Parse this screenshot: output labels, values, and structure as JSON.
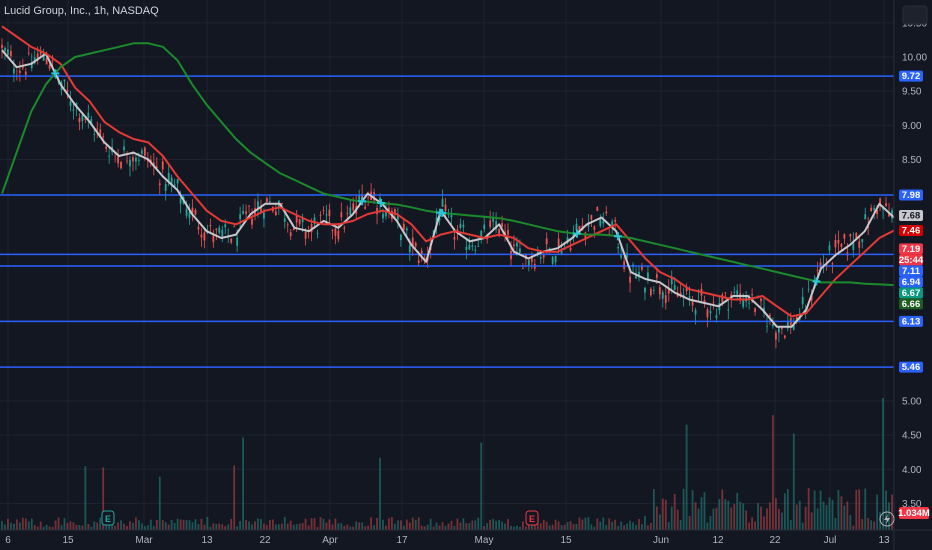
{
  "header": {
    "title": "Lucid Group, Inc., 1h, NASDAQ"
  },
  "chart_data": {
    "type": "candlestick",
    "symbol": "Lucid Group, Inc.",
    "interval": "1h",
    "exchange": "NASDAQ",
    "y_axis": {
      "ticks": [
        "10.50",
        "10.00",
        "9.50",
        "9.00",
        "8.50",
        "5.00",
        "4.50",
        "4.00",
        "3.50"
      ],
      "tick_values": [
        10.5,
        10.0,
        9.5,
        9.0,
        8.5,
        5.0,
        4.5,
        4.0,
        3.5
      ],
      "ylim": [
        5.2,
        10.7
      ]
    },
    "x_axis": {
      "ticks": [
        "6",
        "15",
        "Mar",
        "13",
        "22",
        "Apr",
        "17",
        "May",
        "15",
        "Jun",
        "12",
        "22",
        "Jul",
        "13"
      ]
    },
    "horizontal_lines": [
      9.72,
      7.98,
      7.11,
      6.94,
      6.13,
      5.46
    ],
    "price_tags": [
      {
        "label": "9.72",
        "value": 9.72,
        "bg": "#2962ff",
        "fg": "#ffffff"
      },
      {
        "label": "7.98",
        "value": 7.98,
        "bg": "#2962ff",
        "fg": "#ffffff"
      },
      {
        "label": "7.68",
        "value": 7.68,
        "bg": "#c8c8cc",
        "fg": "#131722"
      },
      {
        "label": "7.46",
        "value": 7.46,
        "bg": "#d50000",
        "fg": "#ffffff"
      },
      {
        "label": "7.19",
        "value": 7.19,
        "bg": "#f23645",
        "fg": "#ffffff"
      },
      {
        "label": "25:44",
        "value": 7.09,
        "bg": "#f23645",
        "fg": "#ffffff"
      },
      {
        "label": "7.11",
        "value": 7.11,
        "bg": "#2962ff",
        "fg": "#ffffff"
      },
      {
        "label": "6.94",
        "value": 6.94,
        "bg": "#2962ff",
        "fg": "#ffffff"
      },
      {
        "label": "6.67",
        "value": 6.67,
        "bg": "#089981",
        "fg": "#ffffff"
      },
      {
        "label": "6.66",
        "value": 6.66,
        "bg": "#1b5e20",
        "fg": "#ffffff"
      },
      {
        "label": "6.13",
        "value": 6.13,
        "bg": "#2962ff",
        "fg": "#ffffff"
      },
      {
        "label": "5.46",
        "value": 5.46,
        "bg": "#2962ff",
        "fg": "#ffffff"
      }
    ],
    "volume_tag": {
      "label": "1.034M",
      "bg": "#f23645",
      "fg": "#ffffff"
    },
    "earnings_markers": [
      {
        "label": "E",
        "color": "#26a69a",
        "x_label": "15"
      },
      {
        "label": "E",
        "color": "#f23645",
        "x_label": "May"
      }
    ],
    "series": [
      {
        "color": "#c8c8cc",
        "values": [
          10.1,
          9.85,
          9.9,
          10.05,
          9.6,
          9.3,
          9.05,
          8.75,
          8.55,
          8.6,
          8.5,
          8.25,
          8.05,
          7.7,
          7.45,
          7.35,
          7.4,
          7.7,
          7.85,
          7.85,
          7.5,
          7.45,
          7.6,
          7.5,
          7.7,
          8.0,
          7.85,
          7.6,
          7.25,
          7.0,
          7.75,
          7.45,
          7.3,
          7.35,
          7.55,
          7.15,
          7.05,
          7.15,
          7.2,
          7.35,
          7.55,
          7.65,
          7.45,
          6.85,
          6.75,
          6.7,
          6.55,
          6.45,
          6.4,
          6.35,
          6.5,
          6.5,
          6.3,
          6.05,
          6.05,
          6.3,
          6.9,
          7.1,
          7.25,
          7.45,
          7.85,
          7.65
        ]
      },
      {
        "color": "#e53935",
        "values": [
          10.45,
          10.3,
          10.15,
          10.05,
          9.9,
          9.55,
          9.35,
          9.05,
          8.9,
          8.8,
          8.75,
          8.55,
          8.25,
          8.0,
          7.75,
          7.6,
          7.55,
          7.65,
          7.75,
          7.8,
          7.7,
          7.6,
          7.55,
          7.55,
          7.6,
          7.7,
          7.75,
          7.7,
          7.55,
          7.3,
          7.4,
          7.45,
          7.4,
          7.35,
          7.4,
          7.35,
          7.2,
          7.15,
          7.15,
          7.25,
          7.35,
          7.45,
          7.55,
          7.3,
          7.05,
          6.85,
          6.75,
          6.6,
          6.55,
          6.5,
          6.45,
          6.45,
          6.5,
          6.35,
          6.2,
          6.25,
          6.5,
          6.75,
          6.95,
          7.15,
          7.35,
          7.46
        ]
      },
      {
        "color": "#1b8a2b",
        "values": [
          8.0,
          8.6,
          9.2,
          9.6,
          9.85,
          10.0,
          10.05,
          10.1,
          10.15,
          10.2,
          10.2,
          10.15,
          9.95,
          9.6,
          9.3,
          9.05,
          8.8,
          8.6,
          8.45,
          8.3,
          8.2,
          8.1,
          8.0,
          7.95,
          7.9,
          7.88,
          7.86,
          7.84,
          7.8,
          7.75,
          7.72,
          7.7,
          7.68,
          7.66,
          7.64,
          7.6,
          7.55,
          7.5,
          7.45,
          7.42,
          7.4,
          7.4,
          7.38,
          7.35,
          7.3,
          7.25,
          7.2,
          7.15,
          7.1,
          7.05,
          7.0,
          6.95,
          6.9,
          6.85,
          6.8,
          6.75,
          6.7,
          6.7,
          6.7,
          6.68,
          6.67,
          6.66
        ]
      }
    ]
  }
}
